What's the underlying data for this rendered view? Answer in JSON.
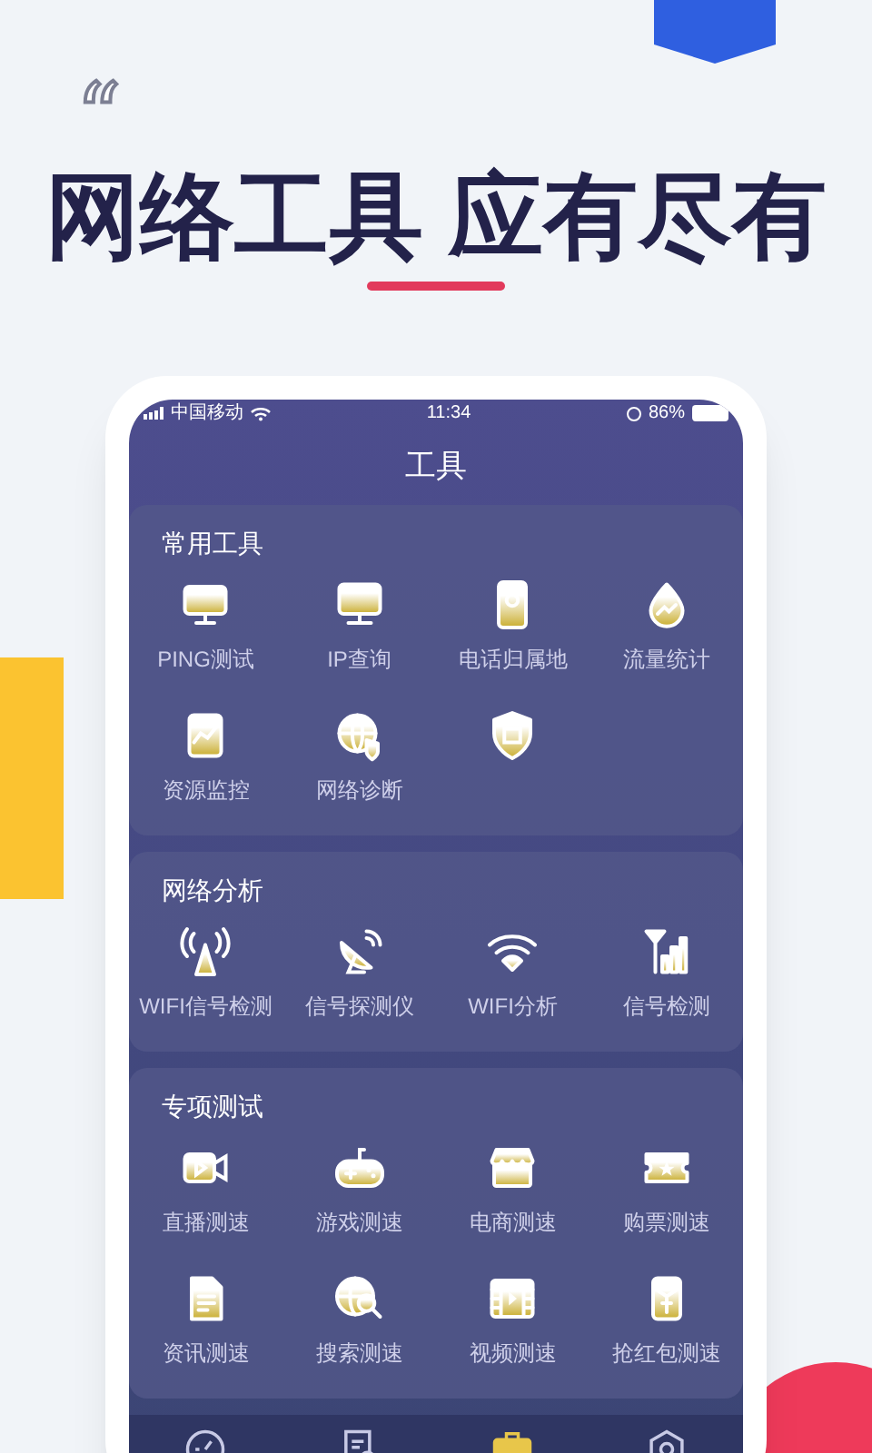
{
  "quote_mark": "“",
  "headline": "网络工具 应有尽有",
  "status_bar": {
    "carrier": "中国移动",
    "time": "11:34",
    "battery": "86%"
  },
  "screen_title": "工具",
  "sections": [
    {
      "title": "常用工具",
      "items": [
        {
          "label": "PING测试"
        },
        {
          "label": "IP查询"
        },
        {
          "label": "电话归属地"
        },
        {
          "label": "流量统计"
        },
        {
          "label": "资源监控"
        },
        {
          "label": "网络诊断"
        },
        {
          "kind": "icon"
        }
      ]
    },
    {
      "title": "网络分析",
      "items": [
        {
          "label": "WIFI信号检测"
        },
        {
          "label": "信号探测仪"
        },
        {
          "label": "WIFI分析"
        },
        {
          "label": "信号检测"
        }
      ]
    },
    {
      "title": "专项测试",
      "items": [
        {
          "label": "直播测速"
        },
        {
          "label": "游戏测速"
        },
        {
          "label": "电商测速"
        },
        {
          "label": "购票测速"
        },
        {
          "label": "资讯测速"
        },
        {
          "label": "搜索测速"
        },
        {
          "label": "视频测速"
        },
        {
          "label": "抢红包测速"
        }
      ]
    }
  ],
  "tab_bar": [
    {
      "selected": false
    },
    {
      "selected": false
    },
    {
      "selected": true
    },
    {
      "selected": false
    }
  ]
}
